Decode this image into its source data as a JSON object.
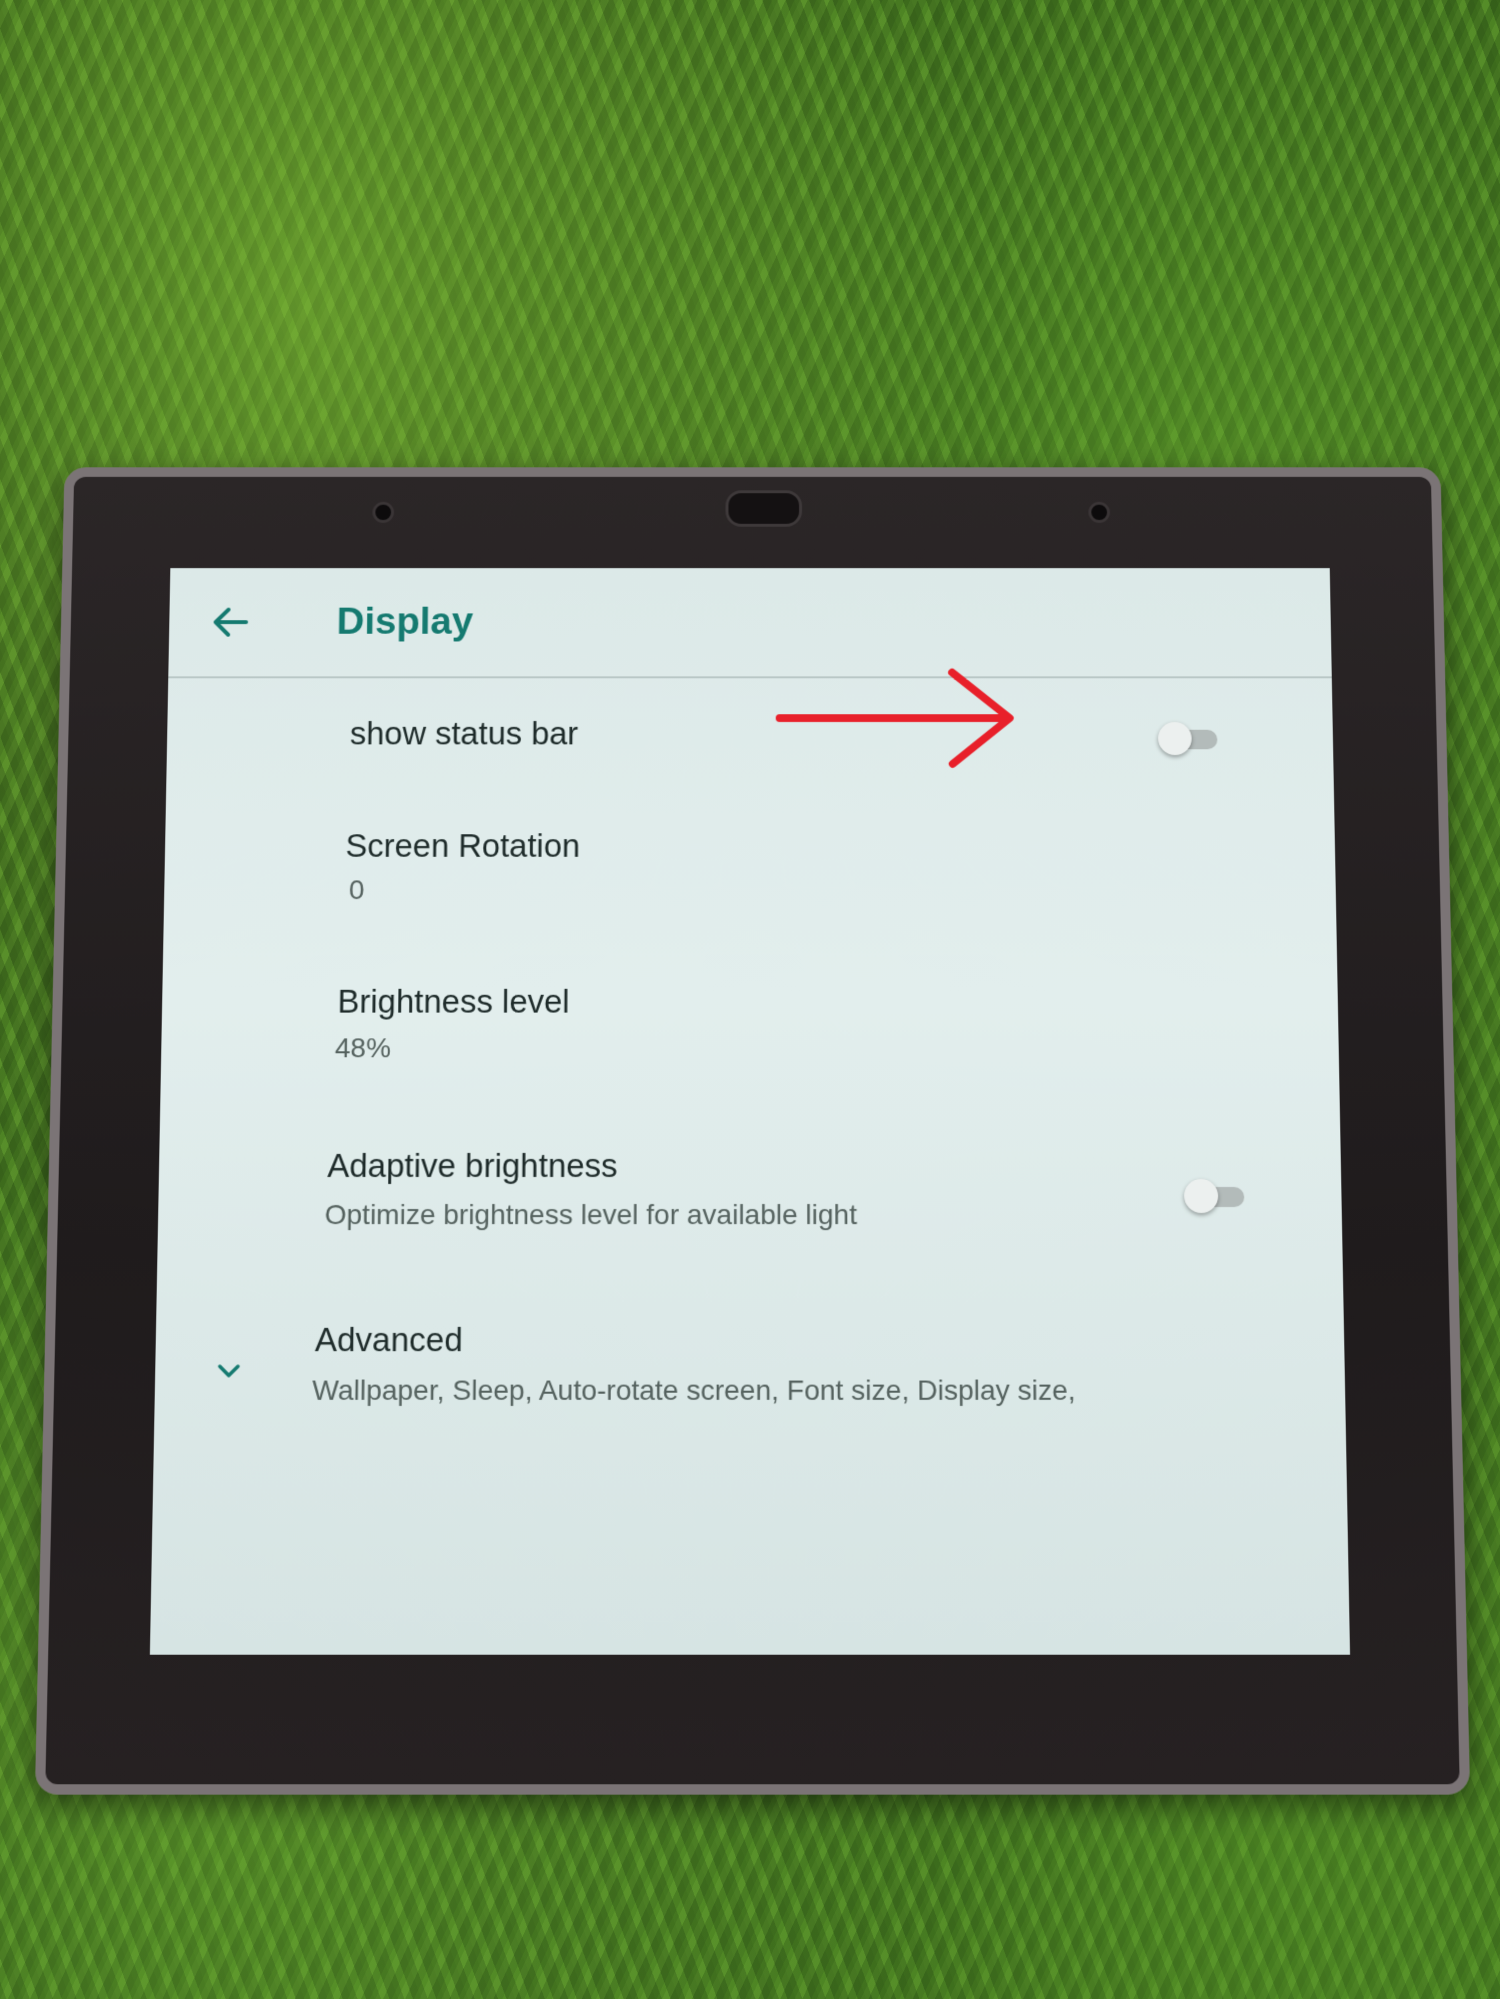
{
  "header": {
    "title": "Display",
    "back_icon": "arrow-left-icon"
  },
  "settings": [
    {
      "title": "show status bar",
      "toggle": false
    },
    {
      "title": "Screen Rotation",
      "value": "0"
    },
    {
      "title": "Brightness level",
      "value": "48%"
    },
    {
      "title": "Adaptive brightness",
      "summary": "Optimize brightness level for available light",
      "toggle": false
    },
    {
      "title": "Advanced",
      "summary": "Wallpaper, Sleep, Auto-rotate screen, Font size, Display size,",
      "icon": "chevron-down-icon"
    }
  ],
  "annotation": {
    "type": "arrow",
    "color": "#e8202a"
  },
  "colors": {
    "accent": "#157a70",
    "screen_bg": "#dce9e8"
  }
}
